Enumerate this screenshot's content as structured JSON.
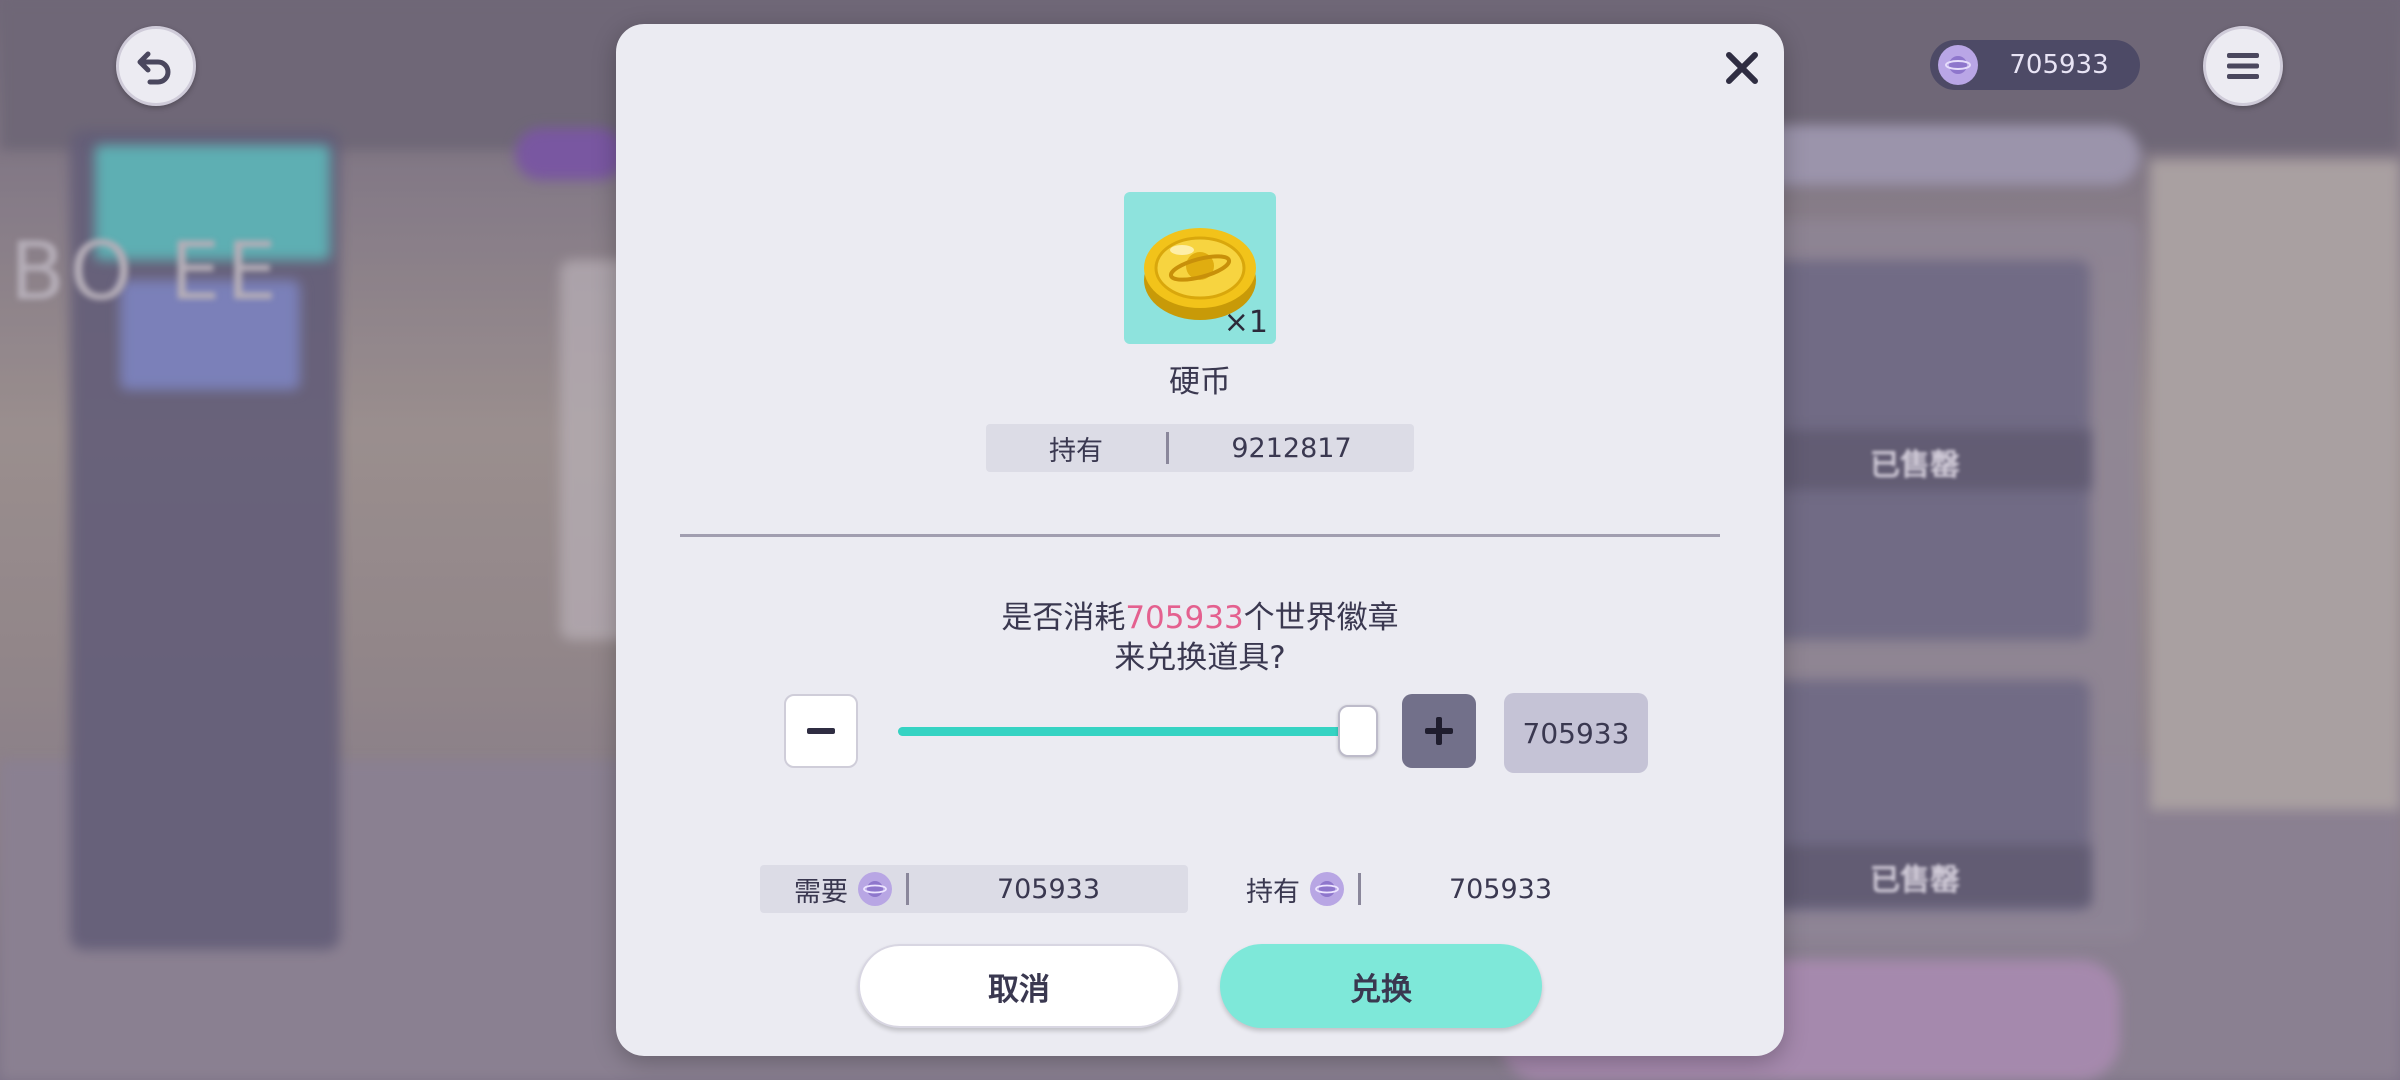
{
  "hud": {
    "currency_value": "705933"
  },
  "dialog": {
    "item": {
      "name": "硬币",
      "quantity": "×1",
      "icon": "gold-coin-icon"
    },
    "holding": {
      "label": "持有",
      "value": "9212817"
    },
    "question": {
      "prefix": "是否消耗",
      "amount": "705933",
      "suffix": "个世界徽章",
      "line2": "来兑换道具?"
    },
    "quantity_selector": {
      "value": "705933",
      "slider_fraction": 1.0
    },
    "cost": {
      "need_label": "需要",
      "need_value": "705933",
      "have_label": "持有",
      "have_value": "705933",
      "currency_icon": "world-badge-icon"
    },
    "buttons": {
      "cancel": "取消",
      "confirm": "兑换"
    }
  },
  "background": {
    "store_text": "BO   EE",
    "sold_label": "已售罄"
  },
  "colors": {
    "accent": "#35d3c3",
    "confirm": "#7ee8d9",
    "highlight": "#e4608f",
    "dialog_bg": "#ebebf2"
  }
}
